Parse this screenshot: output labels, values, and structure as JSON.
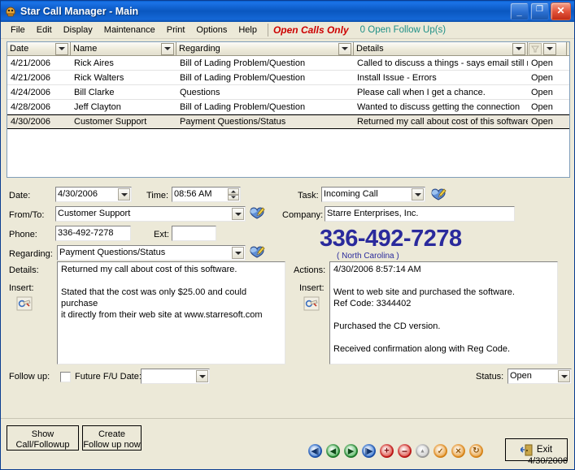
{
  "window": {
    "title": "Star Call Manager - Main",
    "icon": "app-star-icon",
    "minimize_label": "_",
    "maximize_label": "❐",
    "close_label": "✕"
  },
  "menu": {
    "items": [
      "File",
      "Edit",
      "Display",
      "Maintenance",
      "Print",
      "Options",
      "Help"
    ],
    "open_calls_only": "Open Calls Only",
    "open_calls_color": "#cc0000",
    "follow_ups_count": "0",
    "follow_ups_label": "Open Follow Up(s)",
    "follow_ups_color": "#1d8f86"
  },
  "grid": {
    "columns": [
      "Date",
      "Name",
      "Regarding",
      "Details"
    ],
    "rows": [
      {
        "date": "4/21/2006",
        "name": "Rick Aires",
        "regarding": "Bill of Lading Problem/Question",
        "details": "Called to discuss a things - says email still not",
        "status": "Open",
        "selected": false
      },
      {
        "date": "4/21/2006",
        "name": "Rick Walters",
        "regarding": "Bill of Lading Problem/Question",
        "details": "Install Issue - Errors",
        "status": "Open",
        "selected": false
      },
      {
        "date": "4/24/2006",
        "name": "Bill Clarke",
        "regarding": "Questions",
        "details": "Please call when I get a chance.",
        "status": "Open",
        "selected": false
      },
      {
        "date": "4/28/2006",
        "name": "Jeff Clayton",
        "regarding": "Bill of Lading Problem/Question",
        "details": "Wanted to discuss getting the connection",
        "status": "Open",
        "selected": false
      },
      {
        "date": "4/30/2006",
        "name": "Customer Support",
        "regarding": "Payment Questions/Status",
        "details": "Returned my call about cost of this software.",
        "status": "Open",
        "selected": true
      }
    ]
  },
  "form": {
    "date_label": "Date:",
    "date_value": "4/30/2006",
    "time_label": "Time:",
    "time_value": "08:56 AM",
    "task_label": "Task:",
    "task_value": "Incoming Call",
    "fromto_label": "From/To:",
    "fromto_value": "Customer Support",
    "company_label": "Company:",
    "company_value": "Starre Enterprises, Inc.",
    "phone_label": "Phone:",
    "phone_value": "336-492-7278",
    "ext_label": "Ext:",
    "ext_value": "",
    "regarding_label": "Regarding:",
    "regarding_value": "Payment Questions/Status",
    "phone_display": "336-492-7278",
    "phone_state": "( North Carolina )",
    "phone_color": "#2a2a9c",
    "details_label": "Details:",
    "details_insert_label": "Insert:",
    "details_text": "Returned my call about cost of this software.\n\nStated that the cost was only $25.00 and could purchase\nit directly from their web site at www.starresoft.com",
    "actions_label": "Actions:",
    "actions_insert_label": "Insert:",
    "actions_text": "4/30/2006 8:57:14 AM\n\nWent to web site and purchased the software.\nRef Code: 3344402\n\nPurchased the CD version.\n\nReceived confirmation along with Reg Code.",
    "followup_label": "Follow up:",
    "future_fu_label": "Future F/U Date:",
    "future_fu_value": "",
    "status_label": "Status:",
    "status_value": "Open"
  },
  "bottom": {
    "show_call_btn": "Show\nCall/Followup",
    "create_fu_btn": "Create\nFollow up now",
    "exit_btn": "Exit",
    "footer_date": "4/30/2006",
    "nav_buttons": [
      {
        "name": "first-record",
        "glyph": "◀|",
        "color": "#1b4fa8"
      },
      {
        "name": "previous-record",
        "glyph": "◀",
        "color": "#1d7a2a"
      },
      {
        "name": "next-record",
        "glyph": "▶",
        "color": "#1d7a2a"
      },
      {
        "name": "last-record",
        "glyph": "|▶",
        "color": "#1b4fa8"
      },
      {
        "name": "add-record",
        "glyph": "+",
        "color": "#bc1414"
      },
      {
        "name": "delete-record",
        "glyph": "−",
        "color": "#bc1414"
      },
      {
        "name": "edit-record",
        "glyph": "▲",
        "color": "#9a9a9a"
      },
      {
        "name": "post-record",
        "glyph": "✓",
        "color": "#d88418"
      },
      {
        "name": "cancel-record",
        "glyph": "✕",
        "color": "#d88418"
      },
      {
        "name": "refresh-record",
        "glyph": "↻",
        "color": "#d88418"
      }
    ]
  }
}
